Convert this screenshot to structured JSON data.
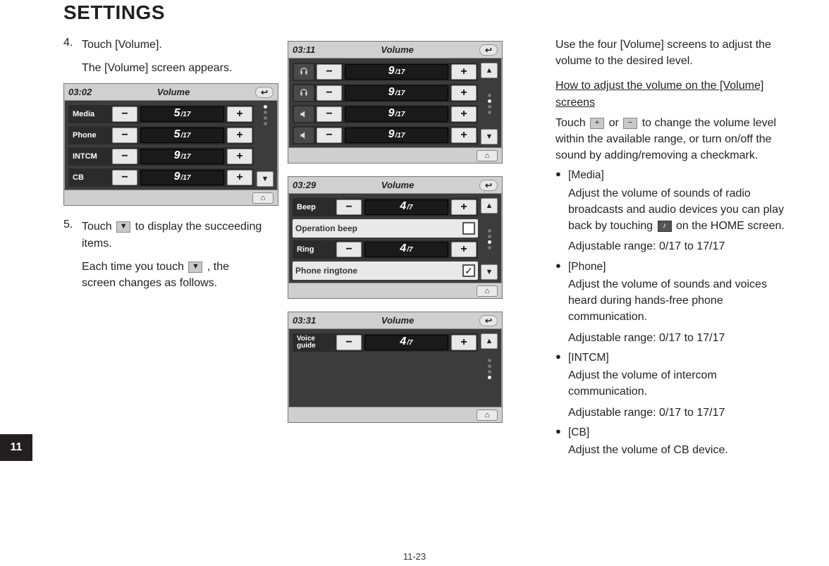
{
  "page_title": "SETTINGS",
  "chapter_tab": "11",
  "page_number": "11-23",
  "left": {
    "step4_num": "4.",
    "step4_text": "Touch [Volume].",
    "step4_sub": "The [Volume] screen appears.",
    "step5_num": "5.",
    "step5_a": "Touch ",
    "step5_b": " to display the succeeding items.",
    "step5_sub_a": "Each time you touch ",
    "step5_sub_b": " , the screen changes as follows."
  },
  "screens": {
    "s1": {
      "clock": "03:02",
      "title": "Volume",
      "rows": [
        {
          "label": "Media",
          "val": "5",
          "max": "/17"
        },
        {
          "label": "Phone",
          "val": "5",
          "max": "/17"
        },
        {
          "label": "INTCM",
          "val": "9",
          "max": "/17"
        },
        {
          "label": "CB",
          "val": "9",
          "max": "/17"
        }
      ]
    },
    "s2": {
      "clock": "03:11",
      "title": "Volume",
      "rows": [
        {
          "icon": "headset1",
          "val": "9",
          "max": "/17"
        },
        {
          "icon": "headset2",
          "val": "9",
          "max": "/17"
        },
        {
          "icon": "speaker",
          "val": "9",
          "max": "/17"
        },
        {
          "icon": "speaker2",
          "val": "9",
          "max": "/17"
        }
      ]
    },
    "s3": {
      "clock": "03:29",
      "title": "Volume",
      "rows": [
        {
          "label": "Beep",
          "val": "4",
          "max": "/7"
        },
        {
          "toggle_label": "Operation beep",
          "checked": false
        },
        {
          "label": "Ring",
          "val": "4",
          "max": "/7"
        },
        {
          "toggle_label": "Phone ringtone",
          "checked": true
        }
      ]
    },
    "s4": {
      "clock": "03:31",
      "title": "Volume",
      "rows": [
        {
          "label_multi": "Voice\nguide",
          "val": "4",
          "max": "/7"
        }
      ]
    }
  },
  "right": {
    "intro": "Use the four [Volume] screens to adjust the volume to the desired level.",
    "subhead": "How to adjust the volume on the [Volume] screens",
    "touch_a": "Touch ",
    "touch_b": " or ",
    "touch_c": " to change the volume level within the available range, or turn on/off the sound by adding/removing a checkmark.",
    "plus": "+",
    "minus": "−",
    "bullets": [
      {
        "title": "[Media]",
        "desc_a": "Adjust the volume of sounds of radio broadcasts and audio devices you can play back by touching ",
        "desc_b": " on the HOME screen.",
        "range": "Adjustable range: 0/17 to 17/17"
      },
      {
        "title": "[Phone]",
        "desc": "Adjust the volume of sounds and voices heard during hands-free phone communication.",
        "range": "Adjustable range: 0/17 to 17/17"
      },
      {
        "title": "[INTCM]",
        "desc": "Adjust the volume of intercom communication.",
        "range": "Adjustable range: 0/17 to 17/17"
      },
      {
        "title": "[CB]",
        "desc": "Adjust the volume of CB device."
      }
    ]
  }
}
